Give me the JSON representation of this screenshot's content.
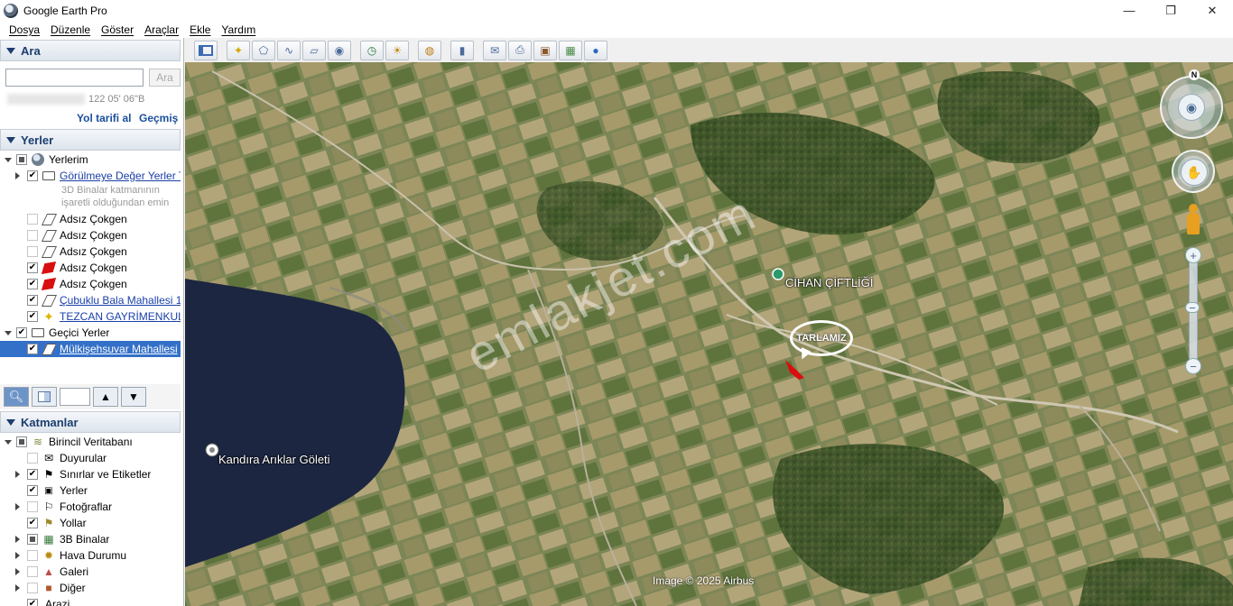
{
  "window": {
    "title": "Google Earth Pro",
    "controls": [
      "—",
      "❐",
      "✕"
    ]
  },
  "menu": [
    "Dosya",
    "Düzenle",
    "Göster",
    "Araçlar",
    "Ekle",
    "Yardım"
  ],
  "search": {
    "header": "Ara",
    "input_value": "",
    "button": "Ara",
    "coords": "122 05' 06\"B",
    "route_link": "Yol tarifi al",
    "history_link": "Geçmiş"
  },
  "places": {
    "header": "Yerler",
    "items": [
      {
        "label": "Yerlerim"
      },
      {
        "label": "Görülmeye Değer Yerler T"
      },
      {
        "label": "3D Binalar katmanının"
      },
      {
        "label": "işaretli olduğundan emin"
      },
      {
        "label": "Adsız Çokgen"
      },
      {
        "label": "Adsız Çokgen"
      },
      {
        "label": "Adsız Çokgen"
      },
      {
        "label": "Adsız Çokgen"
      },
      {
        "label": "Adsız Çokgen"
      },
      {
        "label": "Çubuklu Bala Mahallesi 1"
      },
      {
        "label": "TEZCAN GAYRİMENKUL"
      },
      {
        "label": "Geçici Yerler"
      },
      {
        "label": "Mülkişehsuvar Mahallesi"
      }
    ]
  },
  "layers": {
    "header": "Katmanlar",
    "items": [
      {
        "label": "Birincil Veritabanı"
      },
      {
        "label": "Duyurular"
      },
      {
        "label": "Sınırlar ve Etiketler"
      },
      {
        "label": "Yerler"
      },
      {
        "label": "Fotoğraflar"
      },
      {
        "label": "Yollar"
      },
      {
        "label": "3B Binalar"
      },
      {
        "label": "Hava Durumu"
      },
      {
        "label": "Galeri"
      },
      {
        "label": "Diğer"
      },
      {
        "label": "Arazi"
      }
    ]
  },
  "map": {
    "lake_label": "Kandıra Arıklar Göleti",
    "farm_label": "CİHAN ÇİFTLİĞİ",
    "bubble_text": "TARLAMIZ",
    "watermark": "emlakjet.com",
    "copyright": "Image © 2025 Airbus",
    "compass_north": "N",
    "zoom_plus": "+",
    "zoom_minus": "−"
  },
  "colors": {
    "lake": "#1c2640",
    "field_dark": "#3f5a2c",
    "field_light": "#a89a6c",
    "parcel": "#d90f0f"
  }
}
